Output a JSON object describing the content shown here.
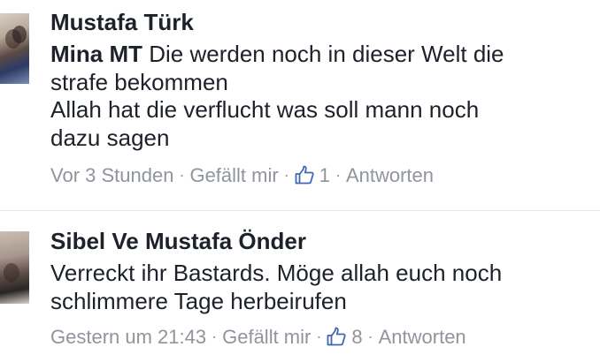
{
  "comments": [
    {
      "author": "Mustafa Türk",
      "mention": "Mina MT",
      "text_line1": " Die werden noch in dieser Welt die",
      "text_line2": "strafe bekommen",
      "text_line3": "Allah hat die verflucht was soll mann noch",
      "text_line4": "dazu sagen",
      "time": "Vor 3 Stunden",
      "like_label": "Gefällt mir",
      "like_count": "1",
      "reply_label": "Antworten",
      "separator": "·",
      "like_icon": "thumbs-up-icon"
    },
    {
      "author": "Sibel Ve Mustafa Önder",
      "text_line1": "Verreckt ihr Bastards. Möge allah euch noch",
      "text_line2": "schlimmere Tage herbeirufen",
      "time": "Gestern um 21:43",
      "like_label": "Gefällt mir",
      "like_count": "8",
      "reply_label": "Antworten",
      "separator": "·",
      "like_icon": "thumbs-up-icon"
    }
  ],
  "colors": {
    "text": "#1d2129",
    "meta": "#90949c",
    "like_blue": "#4267b2",
    "divider": "#e5e6e9"
  }
}
